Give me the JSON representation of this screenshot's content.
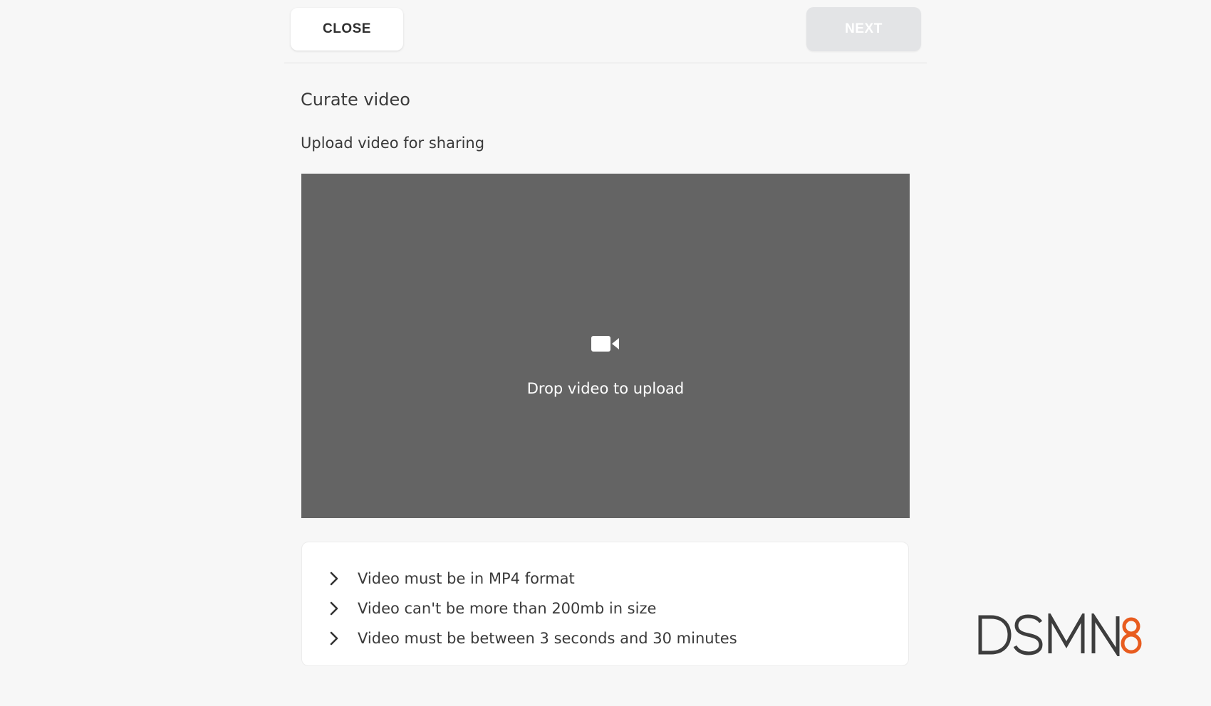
{
  "header": {
    "close_label": "CLOSE",
    "next_label": "NEXT"
  },
  "main": {
    "title": "Curate video",
    "subtitle": "Upload video for sharing",
    "dropzone": {
      "icon": "video-camera-icon",
      "label": "Drop video to upload"
    },
    "requirements": [
      "Video must be in MP4 format",
      "Video can't be more than 200mb in size",
      "Video must be between 3 seconds and 30 minutes"
    ]
  },
  "branding": {
    "logo_text": "DSMN8",
    "logo_colors": {
      "text": "#3d3d3d",
      "accent": "#e85c1f"
    }
  },
  "colors": {
    "background": "#f7f7f7",
    "dropzone": "#646464",
    "next_disabled": "#e3e4e6"
  }
}
